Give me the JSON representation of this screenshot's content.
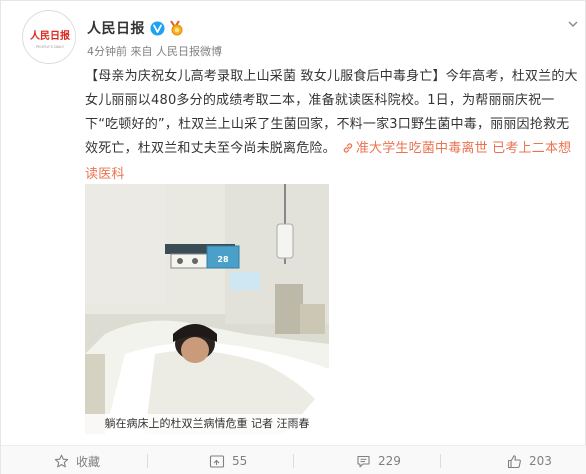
{
  "post": {
    "author": "人民日报",
    "avatar_logo_text": "人民日报",
    "avatar_logo_subtext": "PEOPLE'S DAILY",
    "time": "4分钟前",
    "source_prefix": "来自",
    "source": "人民日报微博",
    "headline": "【母亲为庆祝女儿高考录取上山采菌 致女儿服食后中毒身亡】",
    "body": "今年高考，杜双兰的大女儿丽丽以480多分的成绩考取二本，准备就读医科院校。1日，为帮丽丽庆祝一下“吃顿好的”，杜双兰上山采了生菌回家，不料一家3口野生菌中毒，丽丽因抢救无效死亡，杜双兰和丈夫至今尚未脱离危险。",
    "link_text": "准大学生吃菌中毒离世 已考上二本想读医科",
    "image_caption": "躺在病床上的杜双兰病情危重 记者 汪雨春"
  },
  "actions": {
    "favorite_label": "收藏",
    "repost_count": "55",
    "comment_count": "229",
    "like_count": "203"
  },
  "colors": {
    "link": "#eb7350",
    "verified": "#1da1f2",
    "muted": "#808080",
    "logo_red": "#d9281e"
  },
  "icons": {
    "verified": "verified-v-icon",
    "medal": "medal-icon",
    "dropdown": "chevron-down-icon",
    "link": "link-icon",
    "favorite": "star-icon",
    "repost": "repost-icon",
    "comment": "comment-icon",
    "like": "thumbs-up-icon"
  }
}
